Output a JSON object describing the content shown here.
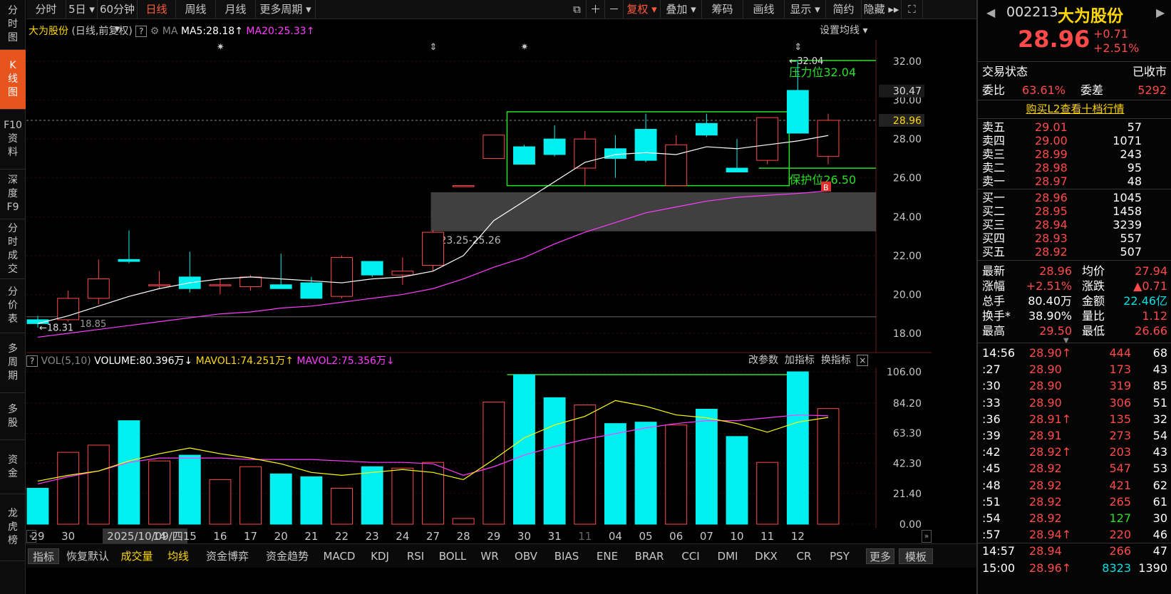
{
  "sidebar": [
    {
      "label": "分时图",
      "active": false
    },
    {
      "label": "K线图",
      "active": true
    },
    {
      "label": "F10资料",
      "active": false
    },
    {
      "label": "深度F9",
      "active": false
    },
    {
      "label": "分时成交",
      "active": false
    },
    {
      "label": "分价表",
      "active": false
    },
    {
      "label": "多周期",
      "active": false
    },
    {
      "label": "多股",
      "active": false
    },
    {
      "label": "资金",
      "active": false
    },
    {
      "label": "龙虎榜",
      "active": false
    }
  ],
  "toolbar": {
    "periods": [
      "分时",
      "5日",
      "60分钟",
      "日线",
      "周线",
      "月线",
      "更多周期"
    ],
    "active_period": "日线",
    "right": [
      "复权",
      "叠加",
      "筹码",
      "画线",
      "显示",
      "简约",
      "隐藏"
    ]
  },
  "chart_header": {
    "name": "大为股份",
    "mode": "(日线,前复权)",
    "ma_label": "MA",
    "ma5": "MA5:28.18",
    "ma20": "MA20:25.33",
    "settings": "设置均线"
  },
  "annotations": {
    "pressure": "压力位32.04",
    "pressure_mark": "32.04",
    "protect": "保护位26.50",
    "box_range": "23.25-25.26",
    "low_mark": "18.31",
    "low_label": "18.85",
    "buy_badge": "B"
  },
  "vol_header": {
    "name": "VOL(5,10)",
    "volume": "VOLUME:80.396万",
    "mavol1": "MAVOL1:74.251万",
    "mavol2": "MAVOL2:75.356万",
    "actions": [
      "改参数",
      "加指标",
      "换指标"
    ]
  },
  "bottom_tabs": [
    "指标",
    "恢复默认",
    "成交量",
    "均线",
    "资金博弈",
    "资金趋势",
    "MACD",
    "KDJ",
    "RSI",
    "BOLL",
    "WR",
    "OBV",
    "BIAS",
    "ENE",
    "BRAR",
    "CCI",
    "DMI",
    "DKX",
    "CR",
    "PSY",
    "更多",
    "模板"
  ],
  "date_highlight": "2025/10/09/四",
  "colors": {
    "up": "#ff4a4a",
    "down": "#00f0f0",
    "ma5": "#ffffff",
    "ma20": "#ff3cff",
    "mavol1": "#ffff00",
    "accent": "#e8541e",
    "green_line": "#28e028"
  },
  "chart_data": {
    "type": "candlestick",
    "price_axis": [
      32.0,
      30.0,
      28.0,
      26.0,
      24.0,
      22.0,
      20.0,
      18.0
    ],
    "price_tags": [
      "30.47",
      "28.96"
    ],
    "vol_axis": [
      106.0,
      84.2,
      63.3,
      42.3,
      21.4,
      0.0
    ],
    "dates": [
      "29",
      "30",
      "",
      "",
      "14",
      "15",
      "16",
      "17",
      "20",
      "21",
      "22",
      "23",
      "24",
      "27",
      "28",
      "29",
      "30",
      "31",
      "11",
      "04",
      "05",
      "06",
      "07",
      "10",
      "11",
      "12"
    ],
    "candles": [
      {
        "o": 18.7,
        "h": 18.9,
        "l": 18.3,
        "c": 18.5
      },
      {
        "o": 18.7,
        "h": 20.2,
        "l": 18.6,
        "c": 19.8
      },
      {
        "o": 19.8,
        "h": 21.8,
        "l": 19.5,
        "c": 20.8
      },
      {
        "o": 21.8,
        "h": 23.3,
        "l": 21.6,
        "c": 21.7
      },
      {
        "o": 20.5,
        "h": 21.2,
        "l": 20.3,
        "c": 20.5
      },
      {
        "o": 20.9,
        "h": 22.2,
        "l": 20.1,
        "c": 20.3
      },
      {
        "o": 20.5,
        "h": 20.8,
        "l": 20.0,
        "c": 20.5
      },
      {
        "o": 20.4,
        "h": 21.0,
        "l": 20.2,
        "c": 20.9
      },
      {
        "o": 20.5,
        "h": 22.1,
        "l": 20.3,
        "c": 20.3
      },
      {
        "o": 20.6,
        "h": 20.9,
        "l": 19.9,
        "c": 19.8
      },
      {
        "o": 19.9,
        "h": 22.0,
        "l": 19.8,
        "c": 21.9
      },
      {
        "o": 21.7,
        "h": 21.7,
        "l": 20.9,
        "c": 21.0
      },
      {
        "o": 21.0,
        "h": 21.9,
        "l": 20.5,
        "c": 21.2
      },
      {
        "o": 21.5,
        "h": 23.3,
        "l": 21.2,
        "c": 23.2
      },
      {
        "o": 25.6,
        "h": 25.6,
        "l": 25.6,
        "c": 25.6
      },
      {
        "o": 27.0,
        "h": 28.2,
        "l": 27.0,
        "c": 28.2
      },
      {
        "o": 27.6,
        "h": 27.7,
        "l": 26.8,
        "c": 26.7
      },
      {
        "o": 28.0,
        "h": 28.7,
        "l": 27.1,
        "c": 27.2
      },
      {
        "o": 26.5,
        "h": 28.4,
        "l": 25.6,
        "c": 28.0
      },
      {
        "o": 27.5,
        "h": 28.2,
        "l": 26.0,
        "c": 27.0
      },
      {
        "o": 28.5,
        "h": 29.3,
        "l": 26.8,
        "c": 26.9
      },
      {
        "o": 25.6,
        "h": 28.2,
        "l": 25.6,
        "c": 27.7
      },
      {
        "o": 28.8,
        "h": 29.3,
        "l": 28.1,
        "c": 28.2
      },
      {
        "o": 26.5,
        "h": 28.0,
        "l": 26.4,
        "c": 26.3
      },
      {
        "o": 26.9,
        "h": 29.1,
        "l": 26.7,
        "c": 29.1
      },
      {
        "o": 30.5,
        "h": 32.04,
        "l": 28.3,
        "c": 28.3
      },
      {
        "o": 27.1,
        "h": 29.3,
        "l": 26.7,
        "c": 28.96
      }
    ],
    "ma5": [
      18.5,
      18.9,
      19.4,
      19.9,
      20.3,
      20.6,
      20.8,
      20.9,
      20.8,
      20.7,
      20.6,
      20.8,
      20.9,
      21.2,
      22.0,
      23.8,
      24.8,
      25.8,
      26.8,
      27.2,
      27.3,
      27.2,
      27.6,
      27.5,
      27.7,
      27.9,
      28.18
    ],
    "ma20": [
      17.8,
      18.0,
      18.2,
      18.4,
      18.6,
      18.8,
      19.0,
      19.1,
      19.3,
      19.4,
      19.6,
      19.8,
      20.0,
      20.3,
      20.8,
      21.4,
      21.9,
      22.6,
      23.2,
      23.7,
      24.2,
      24.5,
      24.8,
      25.0,
      25.1,
      25.2,
      25.33
    ],
    "volumes": [
      25,
      50,
      55,
      72,
      44,
      48,
      31,
      40,
      35,
      33,
      25,
      40,
      39,
      43,
      4,
      85,
      104,
      88,
      83,
      70,
      71,
      69,
      80,
      61,
      43,
      106,
      80.4
    ],
    "mavol1": [
      30,
      34,
      37,
      44,
      49,
      53,
      49,
      46,
      42,
      36,
      34,
      36,
      38,
      36,
      31,
      45,
      60,
      69,
      75,
      86,
      82,
      76,
      74,
      70,
      64,
      71,
      74.25
    ],
    "mavol2": [
      28,
      33,
      37,
      43,
      46,
      46,
      46,
      45,
      45,
      45,
      44,
      43,
      43,
      42,
      34,
      40,
      48,
      54,
      59,
      63,
      67,
      70,
      72,
      72,
      74,
      76,
      75.36
    ]
  },
  "quote": {
    "code": "002213",
    "name": "大为股份",
    "price": "28.96",
    "change": "+0.71",
    "change_pct": "+2.51%",
    "status_label": "交易状态",
    "status": "已收市",
    "weibi_label": "委比",
    "weibi": "63.61%",
    "weicha_label": "委差",
    "weicha": "5292",
    "l2_link": "购买L2查看十档行情",
    "sell": [
      {
        "label": "卖五",
        "price": "29.01",
        "vol": "57"
      },
      {
        "label": "卖四",
        "price": "29.00",
        "vol": "1071"
      },
      {
        "label": "卖三",
        "price": "28.99",
        "vol": "243"
      },
      {
        "label": "卖二",
        "price": "28.98",
        "vol": "95"
      },
      {
        "label": "卖一",
        "price": "28.97",
        "vol": "48"
      }
    ],
    "buy": [
      {
        "label": "买一",
        "price": "28.96",
        "vol": "1045"
      },
      {
        "label": "买二",
        "price": "28.95",
        "vol": "1458"
      },
      {
        "label": "买三",
        "price": "28.94",
        "vol": "3239"
      },
      {
        "label": "买四",
        "price": "28.93",
        "vol": "557"
      },
      {
        "label": "买五",
        "price": "28.92",
        "vol": "507"
      }
    ],
    "stats": [
      {
        "l1": "最新",
        "v1": "28.96",
        "c1": "red",
        "l2": "均价",
        "v2": "27.94",
        "c2": "red"
      },
      {
        "l1": "涨幅",
        "v1": "+2.51%",
        "c1": "red",
        "l2": "涨跌",
        "v2": "▲0.71",
        "c2": "red"
      },
      {
        "l1": "总手",
        "v1": "80.40万",
        "c1": "white",
        "l2": "金额",
        "v2": "22.46亿",
        "c2": "cyan"
      },
      {
        "l1": "换手*",
        "v1": "38.90%",
        "c1": "white",
        "l2": "量比",
        "v2": "1.12",
        "c2": "red"
      },
      {
        "l1": "最高",
        "v1": "29.50",
        "c1": "red",
        "l2": "最低",
        "v2": "26.66",
        "c2": "red"
      }
    ],
    "ticks": [
      {
        "t": "14:56",
        "p": "28.90",
        "arrow": "↑",
        "v": "444",
        "n": "68",
        "vc": "red"
      },
      {
        "t": ":27",
        "p": "28.90",
        "arrow": "",
        "v": "173",
        "n": "43",
        "vc": "red"
      },
      {
        "t": ":30",
        "p": "28.90",
        "arrow": "",
        "v": "319",
        "n": "85",
        "vc": "red"
      },
      {
        "t": ":33",
        "p": "28.90",
        "arrow": "",
        "v": "306",
        "n": "51",
        "vc": "red"
      },
      {
        "t": ":36",
        "p": "28.91",
        "arrow": "↑",
        "v": "135",
        "n": "32",
        "vc": "red"
      },
      {
        "t": ":39",
        "p": "28.91",
        "arrow": "",
        "v": "273",
        "n": "54",
        "vc": "red"
      },
      {
        "t": ":42",
        "p": "28.92",
        "arrow": "↑",
        "v": "203",
        "n": "43",
        "vc": "red"
      },
      {
        "t": ":45",
        "p": "28.92",
        "arrow": "",
        "v": "547",
        "n": "53",
        "vc": "red"
      },
      {
        "t": ":48",
        "p": "28.92",
        "arrow": "",
        "v": "421",
        "n": "62",
        "vc": "red"
      },
      {
        "t": ":51",
        "p": "28.92",
        "arrow": "",
        "v": "265",
        "n": "61",
        "vc": "red"
      },
      {
        "t": ":54",
        "p": "28.92",
        "arrow": "",
        "v": "127",
        "n": "30",
        "vc": "green"
      },
      {
        "t": ":57",
        "p": "28.94",
        "arrow": "↑",
        "v": "220",
        "n": "46",
        "vc": "red"
      },
      {
        "t": "14:57",
        "p": "28.94",
        "arrow": "",
        "v": "266",
        "n": "47",
        "vc": "red"
      },
      {
        "t": "15:00",
        "p": "28.96",
        "arrow": "↑",
        "v": "8323",
        "n": "1390",
        "vc": "cyan"
      }
    ]
  }
}
